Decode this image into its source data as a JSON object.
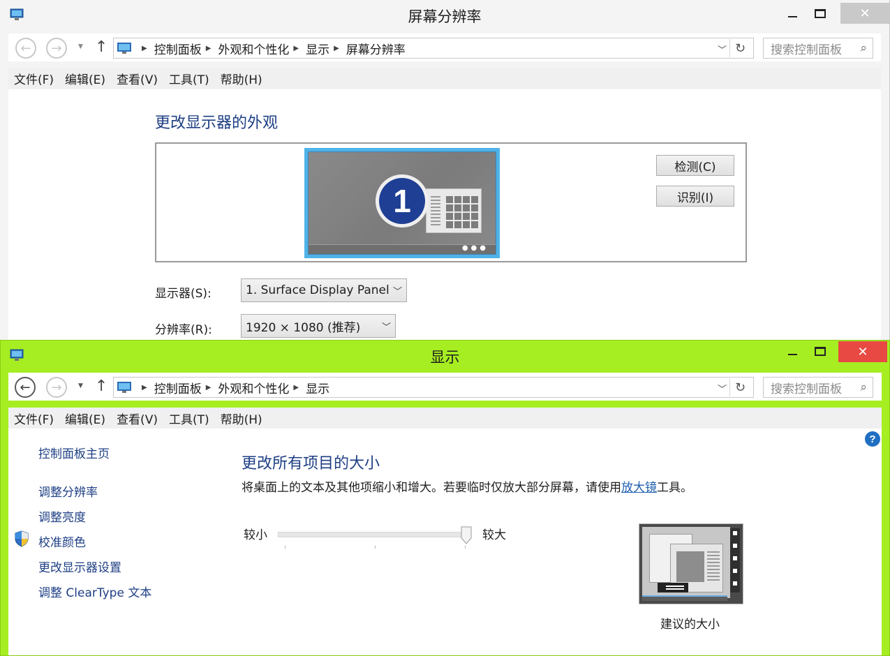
{
  "back_window": {
    "title": "屏幕分辨率",
    "breadcrumbs": [
      "控制面板",
      "外观和个性化",
      "显示",
      "屏幕分辨率"
    ],
    "search_placeholder": "搜索控制面板",
    "menu": [
      "文件(F)",
      "编辑(E)",
      "查看(V)",
      "工具(T)",
      "帮助(H)"
    ],
    "heading": "更改显示器的外观",
    "monitor_number": "1",
    "detect_label": "检测(C)",
    "identify_label": "识别(I)",
    "display_label": "显示器(S):",
    "display_value": "1. Surface Display Panel",
    "resolution_label": "分辨率(R):",
    "resolution_value": "1920 × 1080 (推荐)"
  },
  "front_window": {
    "title": "显示",
    "accent_color": "#a6ee22",
    "close_color": "#e84a43",
    "breadcrumbs": [
      "控制面板",
      "外观和个性化",
      "显示"
    ],
    "search_placeholder": "搜索控制面板",
    "menu": [
      "文件(F)",
      "编辑(E)",
      "查看(V)",
      "工具(T)",
      "帮助(H)"
    ],
    "sidebar": {
      "home": "控制面板主页",
      "links": [
        "调整分辨率",
        "调整亮度",
        "校准颜色",
        "更改显示器设置",
        "调整 ClearType 文本"
      ]
    },
    "heading": "更改所有项目的大小",
    "description_before": "将桌面上的文本及其他项缩小和增大。若要临时仅放大部分屏幕，请使用",
    "description_link": "放大镜",
    "description_after": "工具。",
    "slider": {
      "min_label": "较小",
      "max_label": "较大",
      "value_fraction": 1.0,
      "tick_count": 3
    },
    "preview_caption": "建议的大小",
    "help_glyph": "?"
  }
}
